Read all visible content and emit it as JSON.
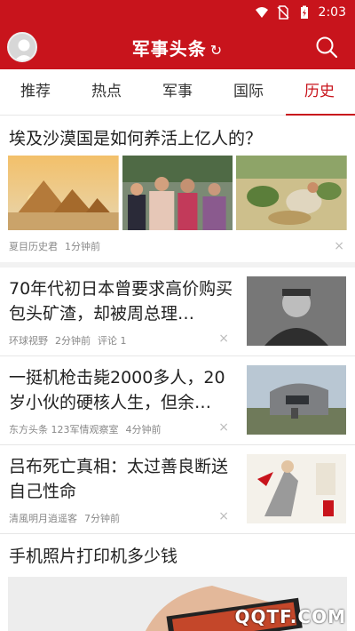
{
  "status": {
    "time": "2:03"
  },
  "header": {
    "title": "军事头条",
    "refresh_icon": "↻"
  },
  "tabs": [
    {
      "label": "推荐"
    },
    {
      "label": "热点"
    },
    {
      "label": "军事"
    },
    {
      "label": "国际"
    },
    {
      "label": "历史",
      "active": true
    }
  ],
  "feed": {
    "featured": {
      "title": "埃及沙漠国是如何养活上亿人的？",
      "source": "夏目历史君",
      "time": "1分钟前",
      "dismiss": "×"
    },
    "items": [
      {
        "title": "70年代初日本曾要求高价购买包头矿渣，却被周总理…",
        "source": "环球视野",
        "time": "2分钟前",
        "comments": "评论 1",
        "dismiss": "×"
      },
      {
        "title": "一挺机枪击毙2000多人，20岁小伙的硬核人生，但余…",
        "source": "东方头条 123军情观察室",
        "time": "4分钟前",
        "dismiss": "×"
      },
      {
        "title": "吕布死亡真相：太过善良断送自己性命",
        "source": "清風明月逍遥客",
        "time": "7分钟前",
        "dismiss": "×"
      }
    ],
    "last": {
      "title": "手机照片打印机多少钱"
    }
  },
  "watermark": "QQTF.COM",
  "colors": {
    "brand": "#c8141c"
  }
}
